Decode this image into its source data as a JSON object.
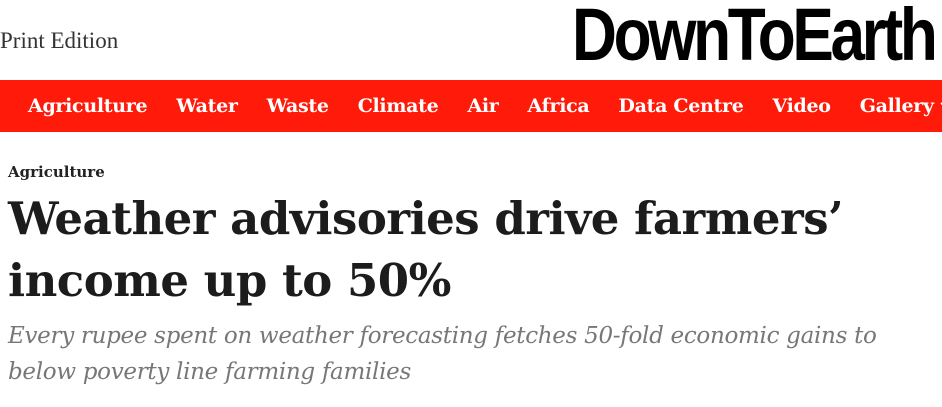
{
  "header": {
    "print_edition_label": "Print Edition",
    "logo_text": "DownToEarth"
  },
  "nav": {
    "items": [
      {
        "label": "Agriculture"
      },
      {
        "label": "Water"
      },
      {
        "label": "Waste"
      },
      {
        "label": "Climate"
      },
      {
        "label": "Air"
      },
      {
        "label": "Africa"
      },
      {
        "label": "Data Centre"
      },
      {
        "label": "Video"
      },
      {
        "label": "Gallery",
        "icon": "chevron-down-icon"
      }
    ],
    "background_color": "#ff1a0a",
    "text_color": "#ffffff"
  },
  "article": {
    "category": "Agriculture",
    "headline": "Weather advisories drive farmers’ income up to 50%",
    "subheadline": "Every rupee spent on weather forecasting fetches 50-fold economic gains to below poverty line farming families"
  }
}
